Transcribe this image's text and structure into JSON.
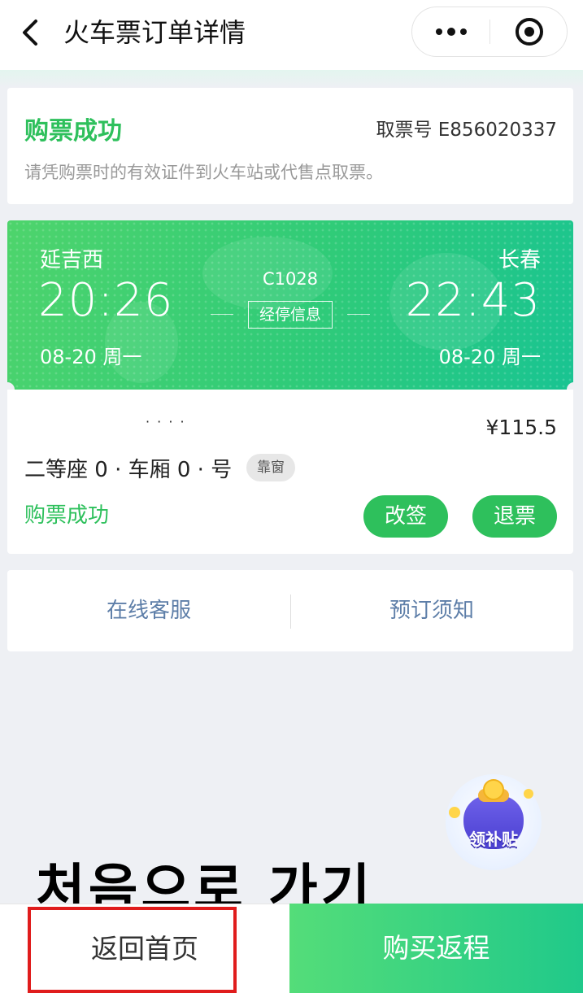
{
  "header": {
    "title": "火车票订单详情"
  },
  "status": {
    "title": "购票成功",
    "pickup_label": "取票号 E856020337",
    "description": "请凭购票时的有效证件到火车站或代售点取票。"
  },
  "train": {
    "from_station": "延吉西",
    "from_time": "20:26",
    "from_date": "08-20 周一",
    "to_station": "长春",
    "to_time": "22:43",
    "to_date": "08-20 周一",
    "train_no": "C1028",
    "stop_info": "经停信息"
  },
  "passenger": {
    "name": "· · · ·",
    "price": "¥115.5",
    "seat": "二等座 0 · 车厢 0 ·  号",
    "seat_tag": "靠窗",
    "ticket_status": "购票成功",
    "change_label": "改签",
    "refund_label": "退票"
  },
  "service": {
    "online_service": "在线客服",
    "booking_notice": "预订须知"
  },
  "subsidy": {
    "label": "领补贴"
  },
  "overlay": {
    "caption": "처음으로 가기"
  },
  "bottom": {
    "home_label": "返回首页",
    "return_label": "购买返程"
  },
  "colors": {
    "brand_green": "#2ec05c",
    "link_blue": "#5d7ea8",
    "highlight_red": "#e01c1c"
  }
}
